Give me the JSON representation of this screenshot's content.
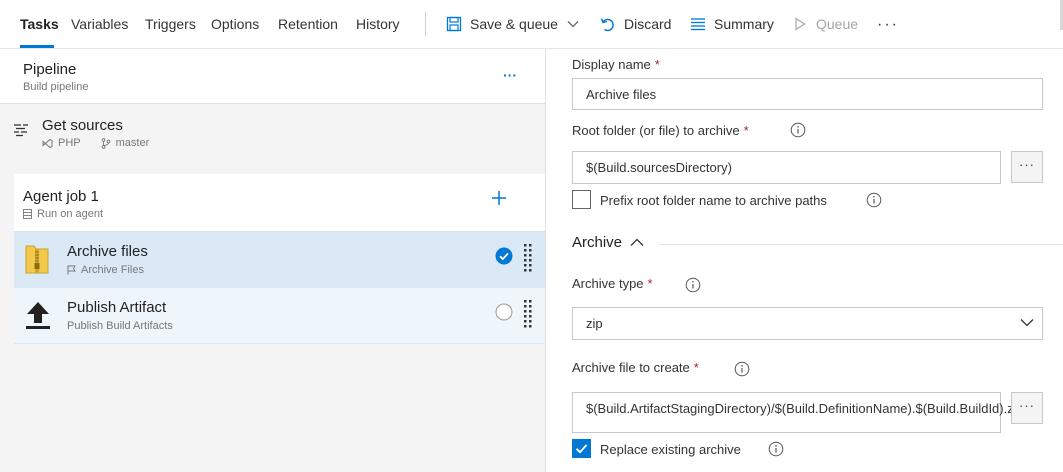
{
  "tabs": [
    {
      "label": "Tasks",
      "active": true
    },
    {
      "label": "Variables",
      "active": false
    },
    {
      "label": "Triggers",
      "active": false
    },
    {
      "label": "Options",
      "active": false
    },
    {
      "label": "Retention",
      "active": false
    },
    {
      "label": "History",
      "active": false
    }
  ],
  "toolbar": {
    "save_queue": "Save & queue",
    "discard": "Discard",
    "summary": "Summary",
    "queue": "Queue",
    "more": "···"
  },
  "pipeline": {
    "title": "Pipeline",
    "subtitle": "Build pipeline",
    "more": "···"
  },
  "sources": {
    "title": "Get sources",
    "repo": "PHP",
    "branch": "master"
  },
  "agent_job": {
    "title": "Agent job 1",
    "subtitle": "Run on agent"
  },
  "tasks": [
    {
      "title": "Archive files",
      "subtitle": "Archive Files",
      "selected": true
    },
    {
      "title": "Publish Artifact",
      "subtitle": "Publish Build Artifacts",
      "selected": false
    }
  ],
  "form": {
    "display_name_label": "Display name",
    "display_name_value": "Archive files",
    "root_folder_label": "Root folder (or file) to archive",
    "root_folder_value": "$(Build.sourcesDirectory)",
    "prefix_label": "Prefix root folder name to archive paths",
    "prefix_checked": false,
    "section_title": "Archive",
    "archive_type_label": "Archive type",
    "archive_type_value": "zip",
    "archive_file_label": "Archive file to create",
    "archive_file_value": "$(Build.ArtifactStagingDirectory)/$(Build.DefinitionName).$(Build.BuildId).zip",
    "replace_label": "Replace existing archive",
    "replace_checked": true,
    "required_mark": "*",
    "dots": "···"
  },
  "colors": {
    "accent": "#0078d4",
    "required": "#a4262c",
    "selected_row": "#dbe9f6"
  }
}
